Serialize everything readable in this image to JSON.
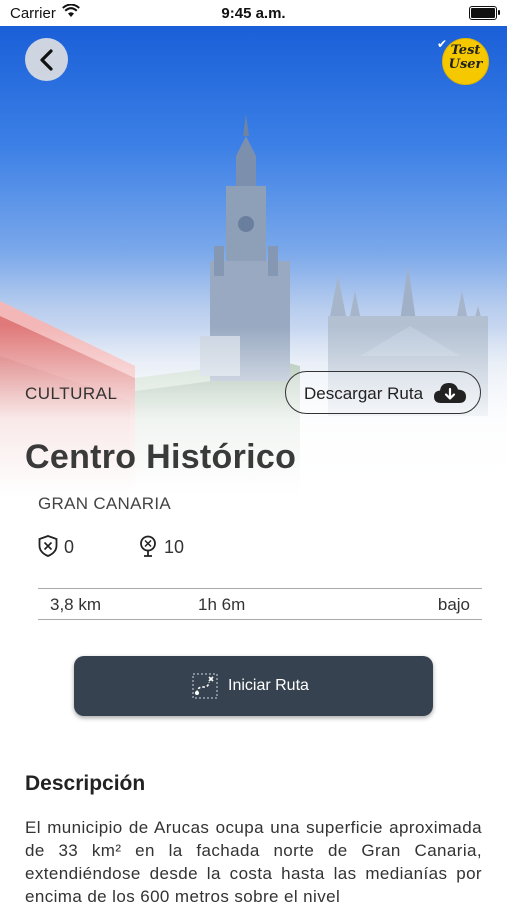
{
  "status_bar": {
    "carrier": "Carrier",
    "time": "9:45 a.m."
  },
  "header": {
    "user_badge": "Test User"
  },
  "route": {
    "category": "CULTURAL",
    "download_label": "Descargar Ruta",
    "title": "Centro Histórico",
    "region": "GRAN CANARIA",
    "stats": {
      "badge_count": "0",
      "poi_count": "10"
    },
    "distance": "3,8 km",
    "duration": "1h 6m",
    "difficulty": "bajo",
    "start_label": "Iniciar Ruta"
  },
  "description": {
    "heading": "Descripción",
    "text": "El municipio de Arucas ocupa una superficie aproximada de 33 km² en la fachada norte de Gran Canaria, extendiéndose desde la costa hasta las medianías por encima de los 600 metros sobre el nivel"
  },
  "colors": {
    "button_dark": "#36424f",
    "avatar_yellow": "#f5c800"
  }
}
